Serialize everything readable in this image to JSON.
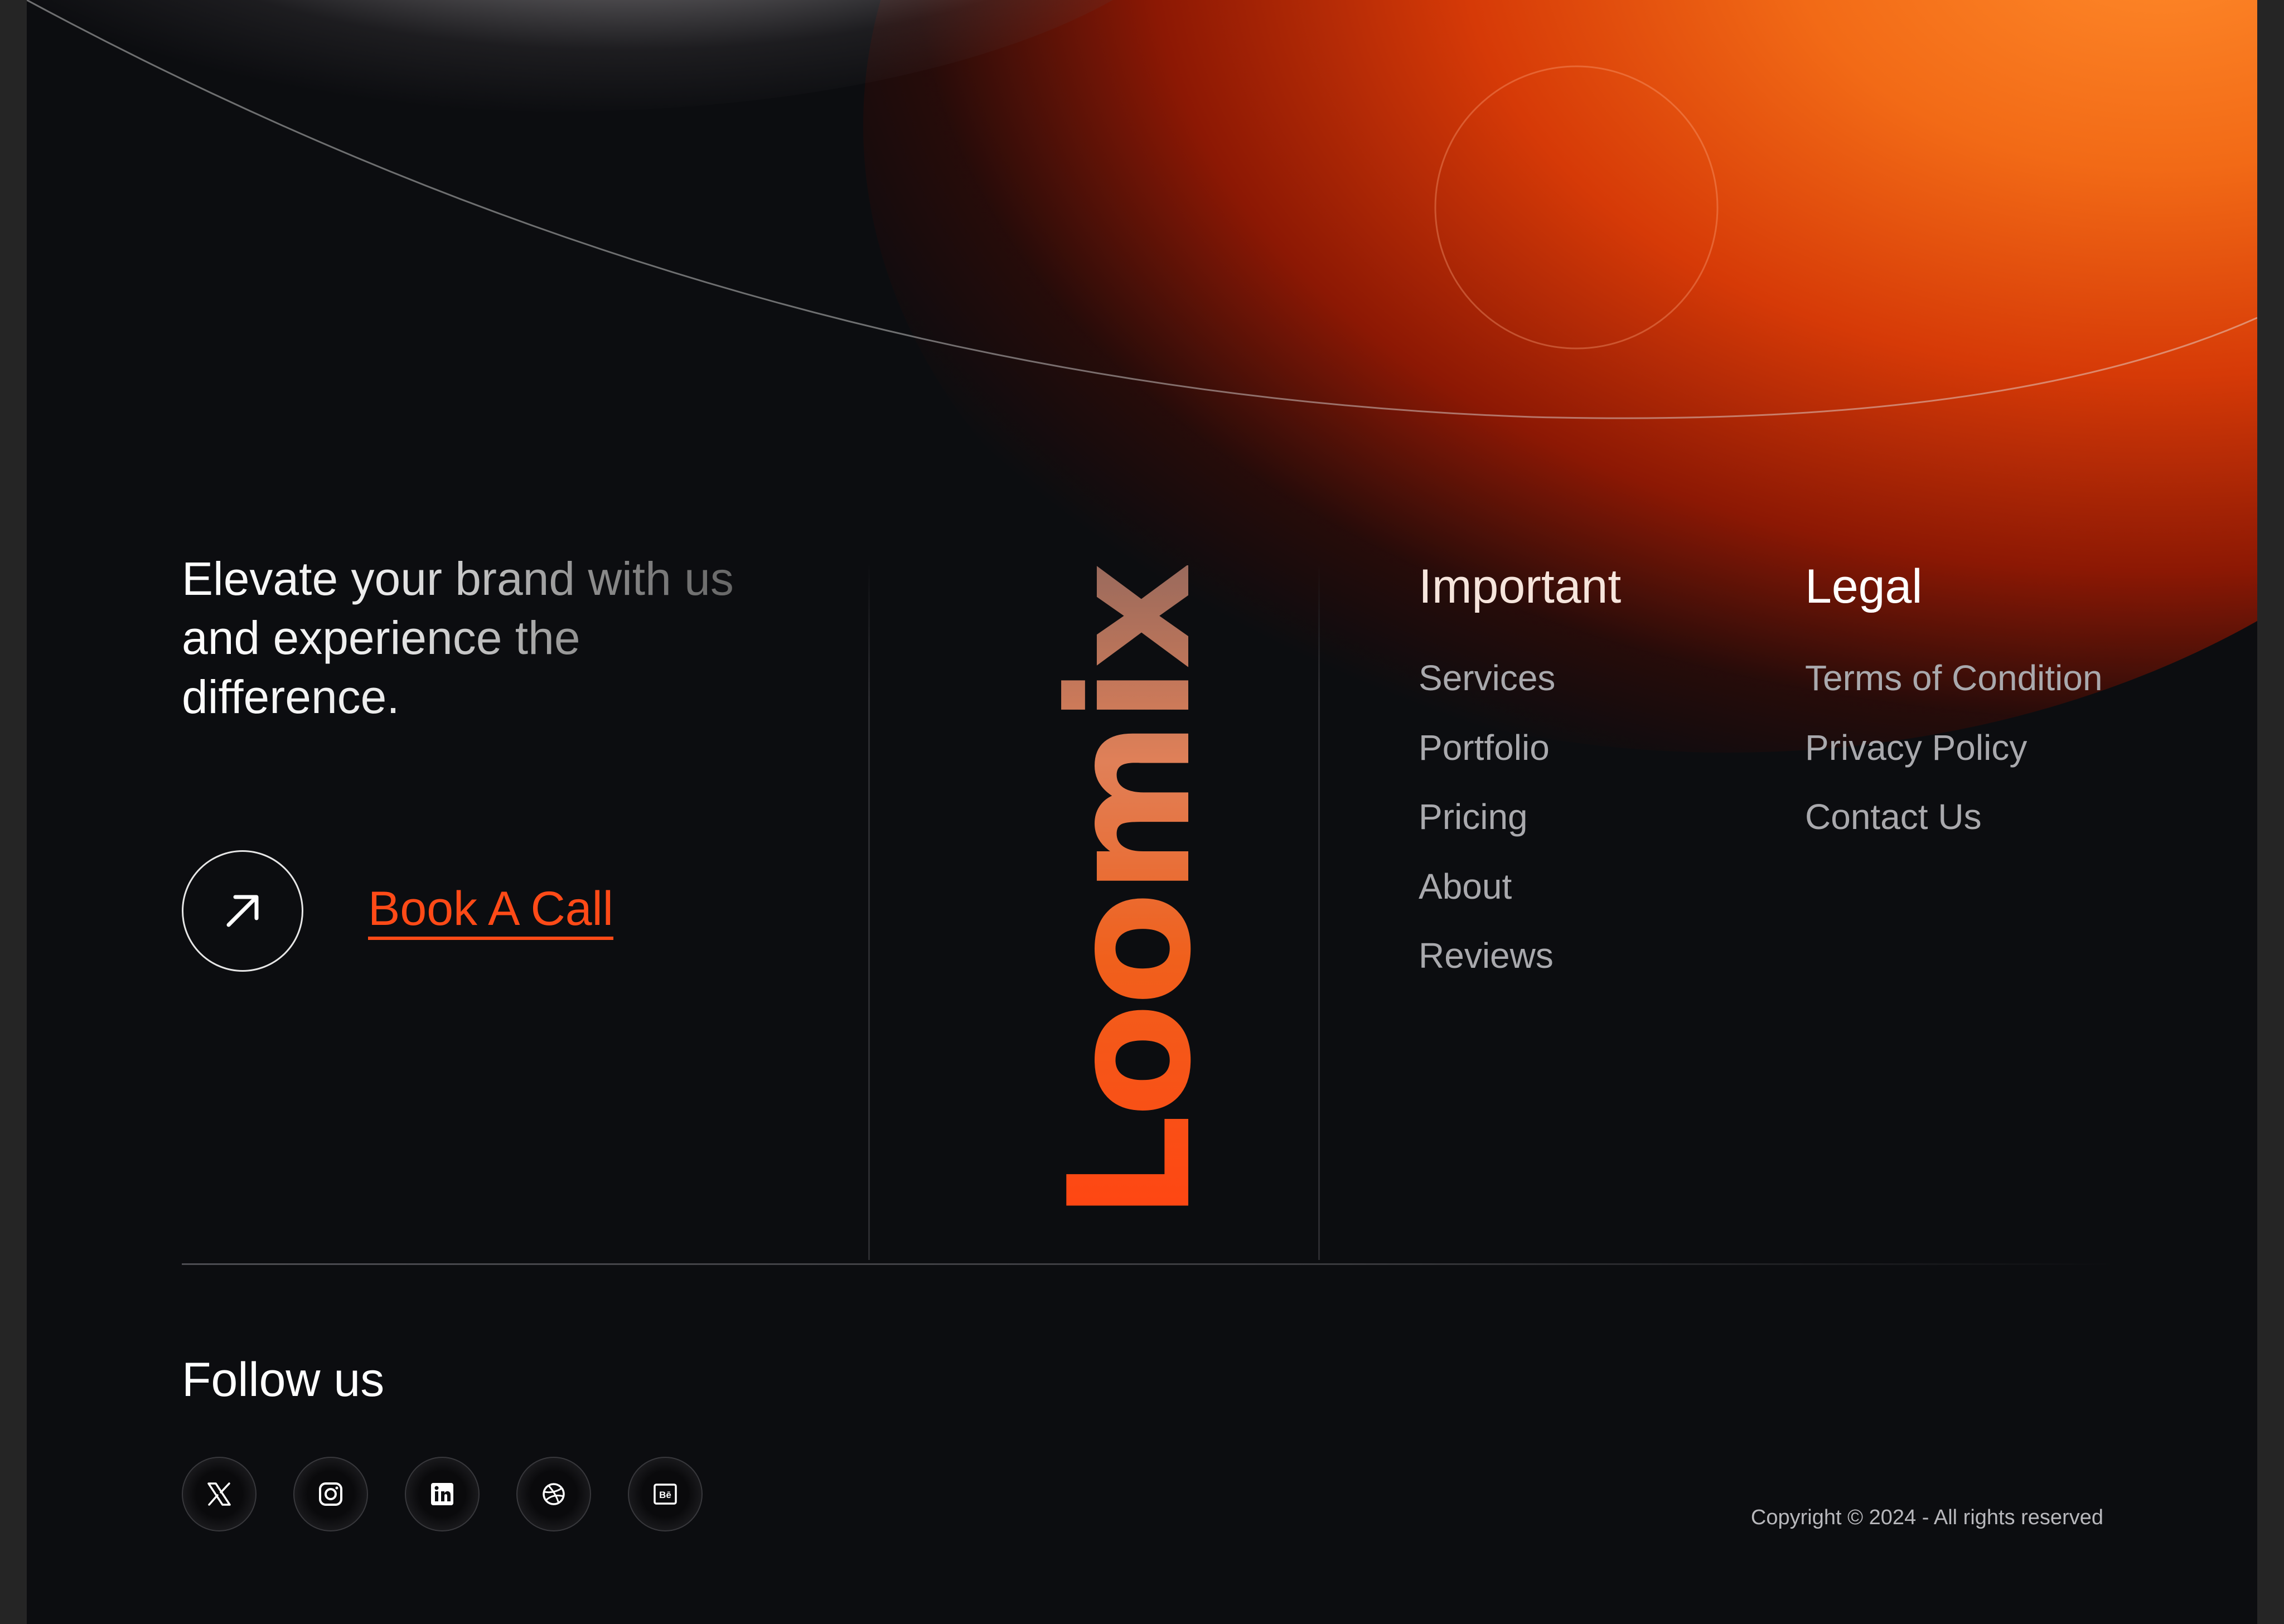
{
  "tagline": "Elevate your brand with us and experience the difference.",
  "cta": {
    "label": "Book A Call"
  },
  "logo": {
    "text": "Loomix"
  },
  "columns": {
    "important": {
      "title": "Important",
      "links": [
        "Services",
        "Portfolio",
        "Pricing",
        "About",
        "Reviews"
      ]
    },
    "legal": {
      "title": "Legal",
      "links": [
        "Terms of Condition",
        "Privacy Policy",
        "Contact Us"
      ]
    }
  },
  "follow": {
    "title": "Follow us",
    "icons": [
      "x-icon",
      "instagram-icon",
      "linkedin-icon",
      "dribbble-icon",
      "behance-icon"
    ]
  },
  "copyright": "Copyright © 2024 - All rights reserved",
  "colors": {
    "background": "#0c0d10",
    "accent": "#ff4a17",
    "glow_orange": "#f26a16",
    "text_muted": "#a9a9ad"
  }
}
